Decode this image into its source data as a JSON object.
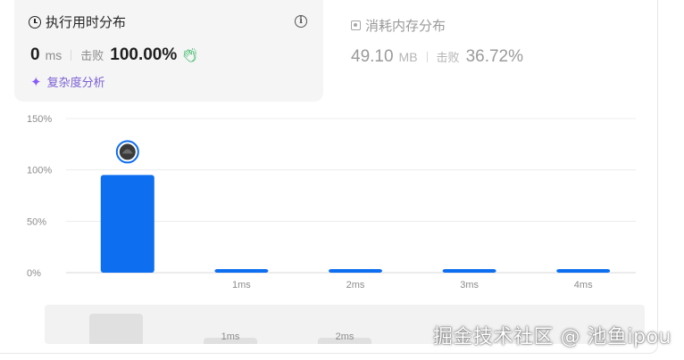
{
  "runtime": {
    "title": "执行用时分布",
    "value": "0",
    "unit": "ms",
    "beats_label": "击败",
    "beats_value": "100.00%",
    "complexity_label": "复杂度分析",
    "info_icon": "i"
  },
  "memory": {
    "title": "消耗内存分布",
    "value": "49.10",
    "unit": "MB",
    "beats_label": "击败",
    "beats_value": "36.72%"
  },
  "colors": {
    "bar": "#0d6ef0",
    "accent_purple": "#7b5fd4",
    "clap_green": "#2db55d"
  },
  "chart_data": {
    "type": "bar",
    "categories": [
      "",
      "1ms",
      "2ms",
      "3ms",
      "4ms"
    ],
    "values": [
      95,
      2,
      2,
      2,
      2
    ],
    "ylim": [
      0,
      150
    ],
    "yticks": [
      "0%",
      "50%",
      "100%",
      "150%"
    ],
    "ytick_values": [
      0,
      50,
      100,
      150
    ],
    "grid": true,
    "marker_on_category": 0
  },
  "overview": {
    "labels": [
      "1ms",
      "2ms"
    ]
  },
  "watermark": "掘金技术社区 @ 池鱼ipou"
}
